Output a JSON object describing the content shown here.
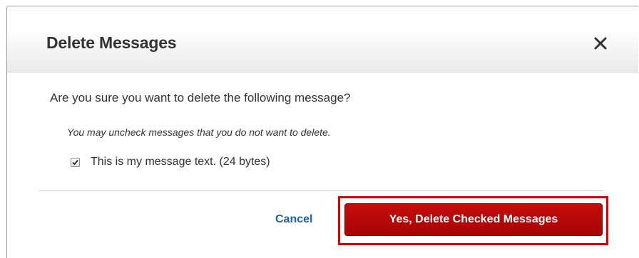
{
  "dialog": {
    "title": "Delete Messages",
    "question": "Are you sure you want to delete the following message?",
    "hint": "You may uncheck messages that you do not want to delete.",
    "messages": [
      {
        "label": "This is my message text. (24 bytes)",
        "checked": true
      }
    ],
    "cancel_label": "Cancel",
    "confirm_label": "Yes, Delete Checked Messages",
    "close_icon": "close-icon"
  },
  "colors": {
    "primary_button": "#b50606",
    "link": "#1e5fa8",
    "highlight": "#e00000",
    "text": "#333333"
  }
}
